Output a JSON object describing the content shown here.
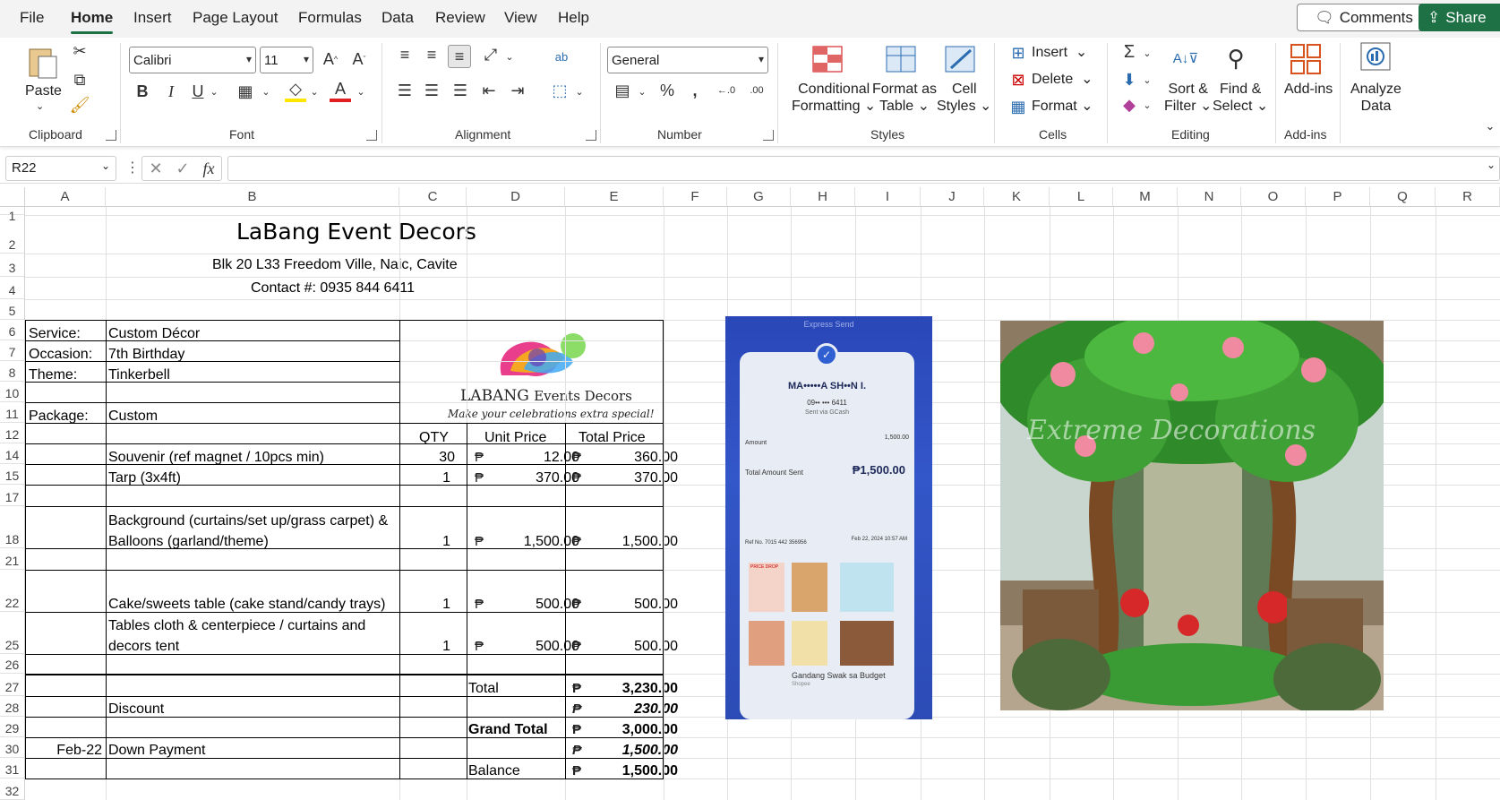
{
  "menu": {
    "items": [
      "File",
      "Home",
      "Insert",
      "Page Layout",
      "Formulas",
      "Data",
      "Review",
      "View",
      "Help"
    ],
    "active": "Home",
    "comments": "Comments",
    "share": "Share"
  },
  "ribbon": {
    "clipboard": {
      "paste": "Paste",
      "label": "Clipboard"
    },
    "font": {
      "name": "Calibri",
      "size": "11",
      "label": "Font"
    },
    "alignment": {
      "label": "Alignment"
    },
    "number": {
      "format": "General",
      "label": "Number"
    },
    "styles": {
      "conditional": "Conditional",
      "formatting": "Formatting",
      "format_as": "Format as",
      "table": "Table",
      "cell": "Cell",
      "styles": "Styles",
      "label": "Styles"
    },
    "cells": {
      "insert": "Insert",
      "delete": "Delete",
      "format": "Format",
      "label": "Cells"
    },
    "editing": {
      "sort": "Sort &",
      "filter": "Filter",
      "find": "Find &",
      "select": "Select",
      "label": "Editing"
    },
    "addins": {
      "addins": "Add-ins",
      "label": "Add-ins"
    },
    "analyze": {
      "analyze": "Analyze",
      "data": "Data"
    }
  },
  "formula_bar": {
    "name_box": "R22",
    "fx": "fx",
    "value": ""
  },
  "columns": [
    "A",
    "B",
    "C",
    "D",
    "E",
    "F",
    "G",
    "H",
    "I",
    "J",
    "K",
    "L",
    "M",
    "N",
    "O",
    "P",
    "Q",
    "R"
  ],
  "rows": [
    "1",
    "2",
    "3",
    "4",
    "5",
    "6",
    "7",
    "8",
    "10",
    "11",
    "12",
    "14",
    "15",
    "17",
    "18",
    "21",
    "22",
    "25",
    "26",
    "27",
    "28",
    "29",
    "30",
    "31",
    "32"
  ],
  "sheet": {
    "company": "LaBang Event Decors",
    "address": "Blk 20 L33 Freedom Ville, Naic, Cavite",
    "contact": "Contact #: 0935 844 6411",
    "service_label": "Service:",
    "service": "Custom Décor",
    "occasion_label": "Occasion:",
    "occasion": "7th Birthday",
    "theme_label": "Theme:",
    "theme": "Tinkerbell",
    "package_label": "Package:",
    "package": "Custom",
    "hdr_qty": "QTY",
    "hdr_unit": "Unit Price",
    "hdr_total": "Total Price",
    "currency": "₱",
    "items": [
      {
        "desc": "Souvenir (ref magnet / 10pcs min)",
        "qty": "30",
        "unit": "12.00",
        "total": "360.00"
      },
      {
        "desc": "Tarp (3x4ft)",
        "qty": "1",
        "unit": "370.00",
        "total": "370.00"
      },
      {
        "desc": "Background (curtains/set up/grass carpet) &",
        "desc2": "Balloons (garland/theme)",
        "qty": "1",
        "unit": "1,500.00",
        "total": "1,500.00"
      },
      {
        "desc": "Cake/sweets table (cake stand/candy trays)",
        "qty": "1",
        "unit": "500.00",
        "total": "500.00"
      },
      {
        "desc": "Tables cloth & centerpiece / curtains and",
        "desc2": "decors tent",
        "qty": "1",
        "unit": "500.00",
        "total": "500.00"
      }
    ],
    "total_label": "Total",
    "total": "3,230.00",
    "discount_label": "Discount",
    "discount": "230.00",
    "grand_label": "Grand Total",
    "grand": "3,000.00",
    "dp_date": "Feb-22",
    "dp_label": "Down Payment",
    "dp": "1,500.00",
    "balance_label": "Balance",
    "balance": "1,500.00"
  },
  "logo": {
    "brand": "LABANG",
    "brand2": "Events Decors",
    "tagline": "Make your celebrations extra special!"
  },
  "receipt": {
    "title": "Express Send",
    "name": "MA•••••A SH••N I.",
    "phone": "09•• ••• 6411",
    "sent_via": "Sent via GCash",
    "amount_label": "Amount",
    "amount": "1,500.00",
    "total_label": "Total Amount Sent",
    "total": "₱1,500.00",
    "ref": "Ref No. 7015 442 356956",
    "date": "Feb 22, 2024 10:57 AM",
    "ad": "Gandang Swak sa Budget",
    "ad_source": "Shopee",
    "price_drop": "PRICE DROP"
  },
  "decor_photo": {
    "watermark": "Extreme Decorations"
  }
}
